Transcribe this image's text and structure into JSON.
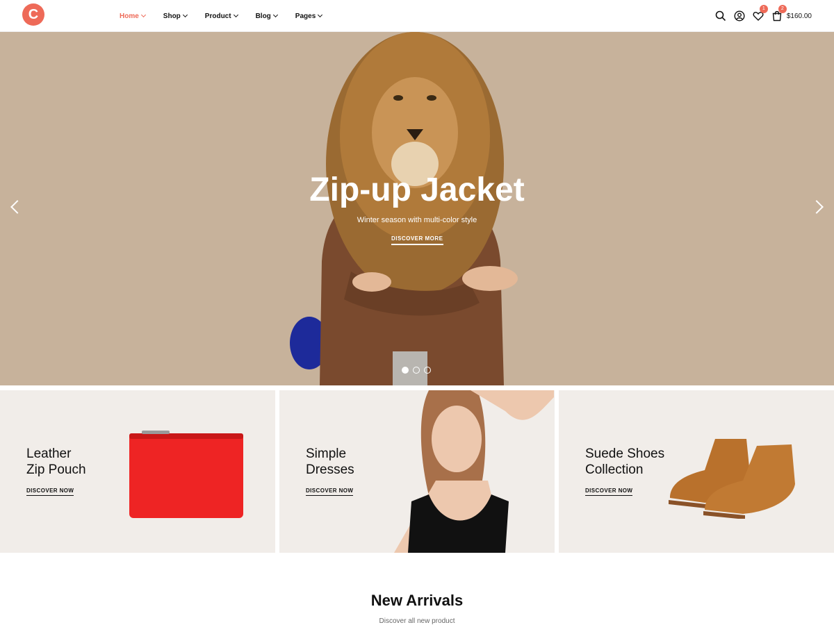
{
  "brand": {
    "logo_letter": "C",
    "accent": "#ee6a58"
  },
  "nav": [
    {
      "label": "Home",
      "active": true
    },
    {
      "label": "Shop",
      "active": false
    },
    {
      "label": "Product",
      "active": false
    },
    {
      "label": "Blog",
      "active": false
    },
    {
      "label": "Pages",
      "active": false
    }
  ],
  "header_actions": {
    "icons": [
      "search-icon",
      "user-icon",
      "heart-icon",
      "cart-icon"
    ],
    "wishlist_count": "1",
    "cart_count": "2",
    "cart_total": "$160.00"
  },
  "hero": {
    "title": "Zip-up Jacket",
    "subtitle": "Winter season with multi-color style",
    "cta": "DISCOVER MORE",
    "background": "#c7b29b",
    "slides": 3,
    "active_slide": 1
  },
  "banners": [
    {
      "title_line1": "Leather",
      "title_line2": "Zip Pouch",
      "cta": "DISCOVER NOW"
    },
    {
      "title_line1": "Simple",
      "title_line2": "Dresses",
      "cta": "DISCOVER NOW"
    },
    {
      "title_line1": "Suede Shoes",
      "title_line2": "Collection",
      "cta": "DISCOVER NOW"
    }
  ],
  "new_arrivals": {
    "title": "New Arrivals",
    "subtitle": "Discover all new product"
  }
}
